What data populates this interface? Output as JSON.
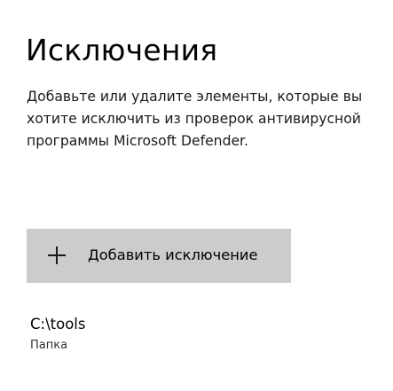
{
  "page": {
    "title": "Исключения",
    "description": "Добавьте или удалите элементы, которые вы хотите исключить из проверок антивирусной программы Microsoft Defender."
  },
  "add_button": {
    "icon": "plus-icon",
    "label": "Добавить исключение"
  },
  "exclusions": [
    {
      "path": "C:\\tools",
      "type": "Папка"
    }
  ],
  "colors": {
    "background": "#ffffff",
    "button_background": "#cccccc",
    "text": "#000000"
  }
}
